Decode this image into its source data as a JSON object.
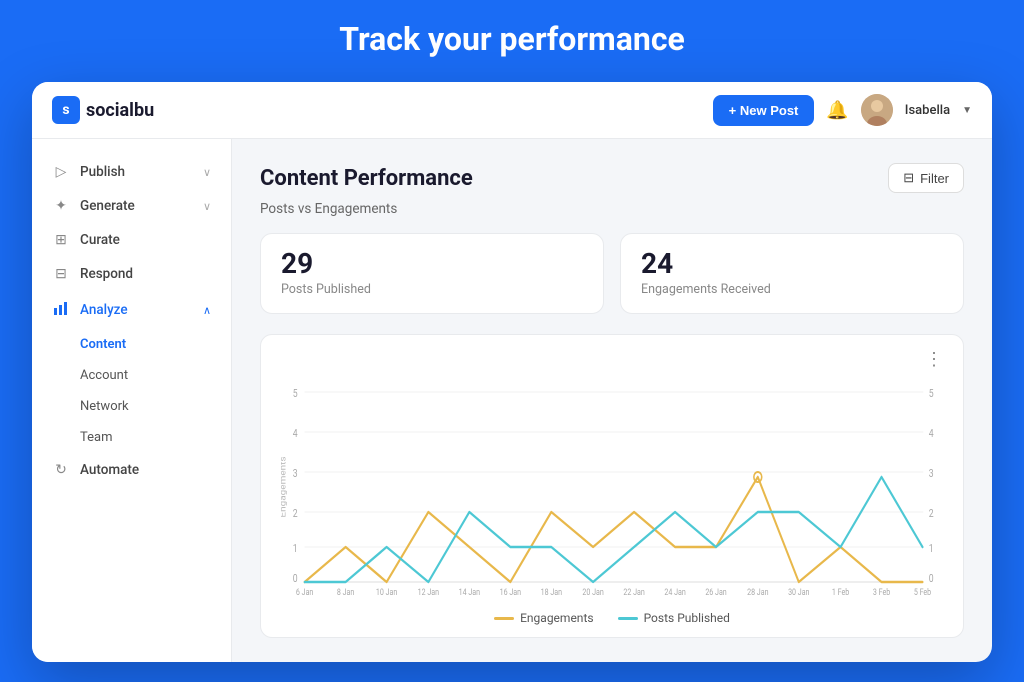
{
  "page": {
    "heading": "Track your performance"
  },
  "topbar": {
    "logo_text": "socialbu",
    "new_post_label": "+ New Post",
    "user_name": "Isabella"
  },
  "sidebar": {
    "items": [
      {
        "id": "publish",
        "label": "Publish",
        "has_chevron": true,
        "active": false
      },
      {
        "id": "generate",
        "label": "Generate",
        "has_chevron": true,
        "active": false
      },
      {
        "id": "curate",
        "label": "Curate",
        "has_chevron": false,
        "active": false
      },
      {
        "id": "respond",
        "label": "Respond",
        "has_chevron": false,
        "active": false
      },
      {
        "id": "analyze",
        "label": "Analyze",
        "has_chevron": true,
        "active": true
      },
      {
        "id": "automate",
        "label": "Automate",
        "has_chevron": false,
        "active": false
      }
    ],
    "analyze_sub": [
      {
        "id": "content",
        "label": "Content",
        "active": true
      },
      {
        "id": "account",
        "label": "Account",
        "active": false
      },
      {
        "id": "network",
        "label": "Network",
        "active": false
      },
      {
        "id": "team",
        "label": "Team",
        "active": false
      }
    ]
  },
  "content": {
    "title": "Content Performance",
    "subtitle": "Posts vs Engagements",
    "filter_label": "Filter",
    "stats": [
      {
        "number": "29",
        "label": "Posts Published"
      },
      {
        "number": "24",
        "label": "Engagements Received"
      }
    ]
  },
  "chart": {
    "x_labels": [
      "6 Jan",
      "8 Jan",
      "10 Jan",
      "12 Jan",
      "14 Jan",
      "16 Jan",
      "18 Jan",
      "20 Jan",
      "22 Jan",
      "24 Jan",
      "26 Jan",
      "28 Jan",
      "30 Jan",
      "1 Feb",
      "3 Feb",
      "5 Feb"
    ],
    "y_left_label": "Engagements",
    "y_right_label": "Posts Published",
    "y_ticks": [
      0,
      1,
      2,
      3,
      4,
      5
    ],
    "legend": [
      {
        "id": "engagements",
        "label": "Engagements",
        "color": "#e8b84b"
      },
      {
        "id": "posts",
        "label": "Posts Published",
        "color": "#4dc8d4"
      }
    ],
    "engagements_data": [
      0,
      1,
      0,
      2,
      1,
      0,
      2,
      1,
      2,
      1,
      1,
      3,
      0,
      1,
      0,
      0
    ],
    "posts_data": [
      0,
      0,
      1,
      0,
      2,
      1,
      1,
      0,
      1,
      2,
      1,
      2,
      2,
      1,
      3,
      1
    ]
  },
  "icons": {
    "publish": "▷",
    "generate": "✦",
    "curate": "⊞",
    "respond": "⊟",
    "analyze": "📊",
    "automate": "↻",
    "bell": "🔔",
    "filter": "⊞",
    "menu_dots": "⋮"
  }
}
